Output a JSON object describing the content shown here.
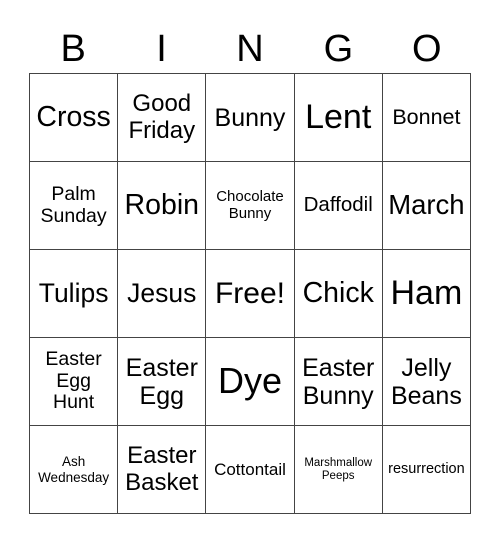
{
  "header": {
    "letters": [
      "B",
      "I",
      "N",
      "G",
      "O"
    ]
  },
  "cells": [
    [
      "Cross",
      "Good\nFriday",
      "Bunny",
      "Lent",
      "Bonnet"
    ],
    [
      "Palm\nSunday",
      "Robin",
      "Chocolate\nBunny",
      "Daffodil",
      "March"
    ],
    [
      "Tulips",
      "Jesus",
      "Free!",
      "Chick",
      "Ham"
    ],
    [
      "Easter\nEgg\nHunt",
      "Easter\nEgg",
      "Dye",
      "Easter\nBunny",
      "Jelly\nBeans"
    ],
    [
      "Ash\nWednesday",
      "Easter\nBasket",
      "Cottontail",
      "Marshmallow\nPeeps",
      "resurrection"
    ]
  ]
}
